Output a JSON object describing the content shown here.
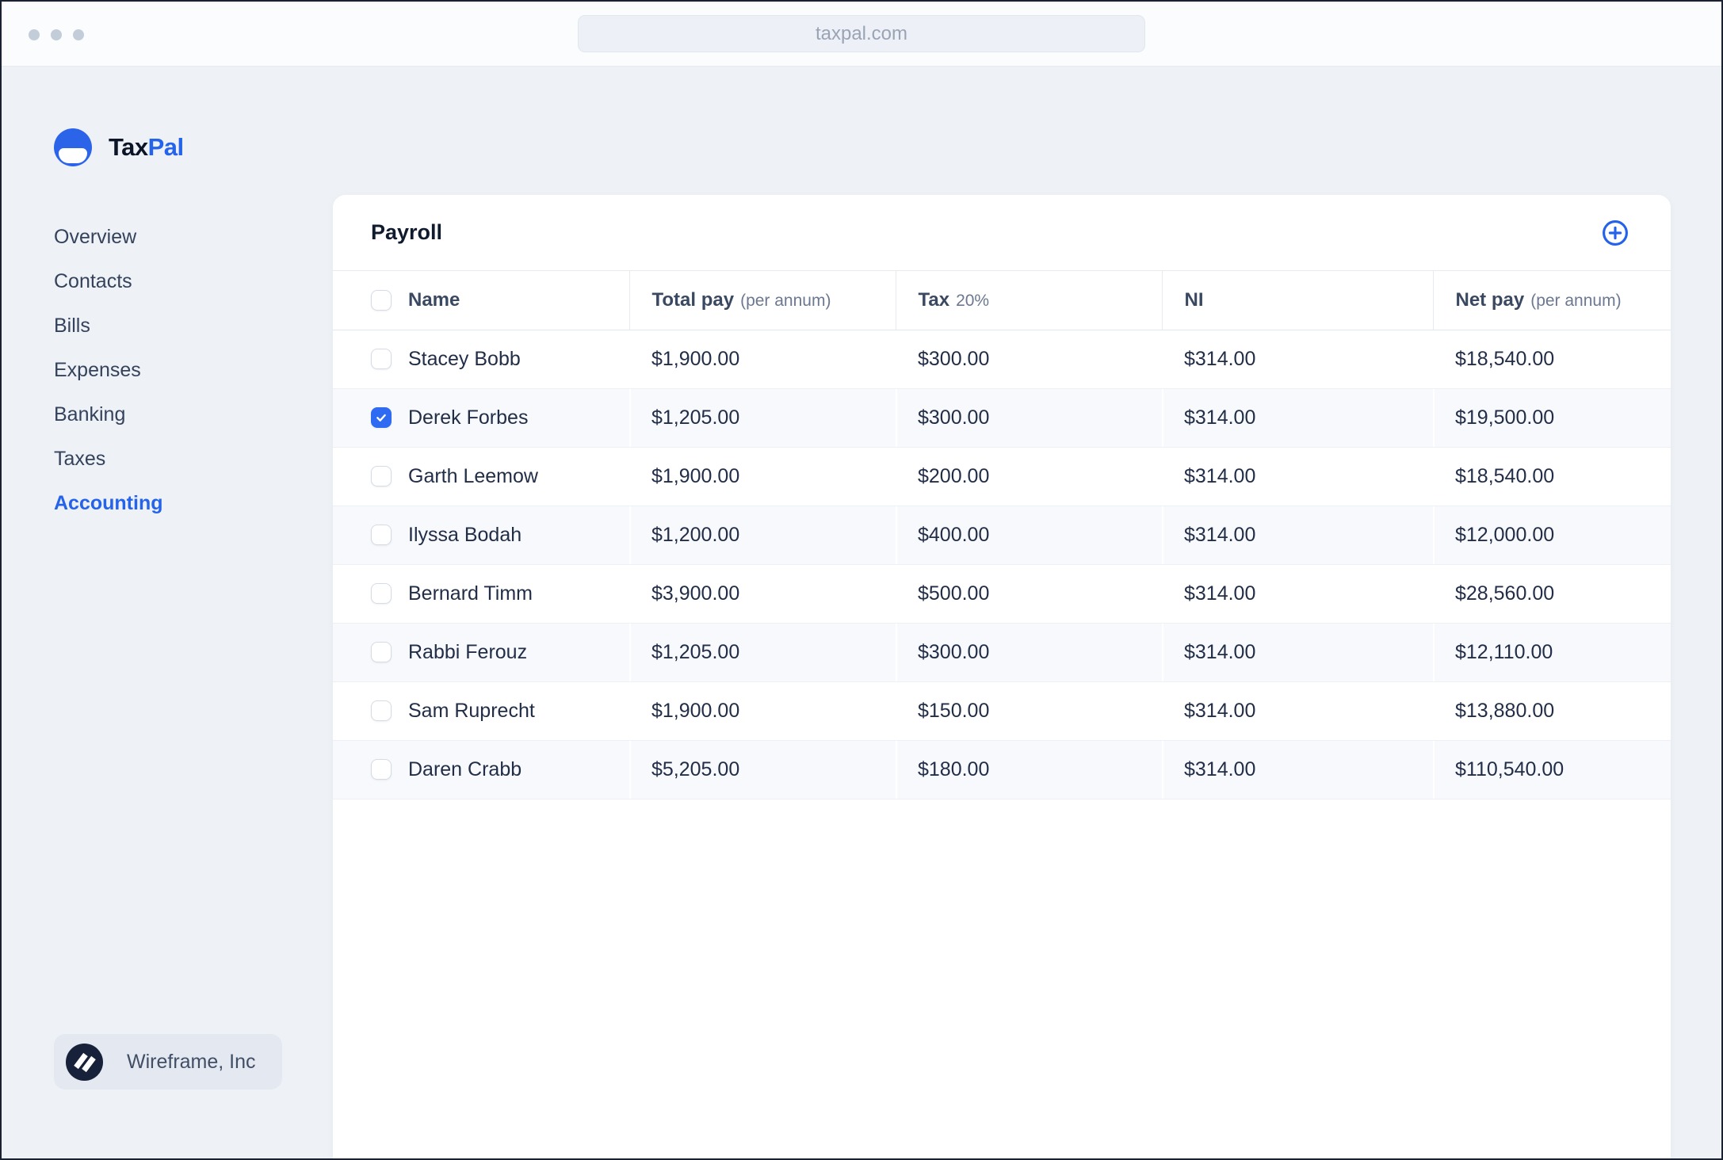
{
  "browser": {
    "url": "taxpal.com"
  },
  "sidebar": {
    "brand": {
      "primary": "Tax",
      "secondary": "Pal"
    },
    "nav": [
      {
        "label": "Overview",
        "active": false
      },
      {
        "label": "Contacts",
        "active": false
      },
      {
        "label": "Bills",
        "active": false
      },
      {
        "label": "Expenses",
        "active": false
      },
      {
        "label": "Banking",
        "active": false
      },
      {
        "label": "Taxes",
        "active": false
      },
      {
        "label": "Accounting",
        "active": true
      }
    ],
    "org": {
      "name": "Wireframe, Inc"
    }
  },
  "payroll": {
    "title": "Payroll",
    "add_button": {
      "icon": "plus-circle-icon"
    },
    "table": {
      "columns": [
        {
          "label": "Name",
          "sub": ""
        },
        {
          "label": "Total pay",
          "sub": "(per annum)"
        },
        {
          "label": "Tax",
          "sub": "20%"
        },
        {
          "label": "NI",
          "sub": ""
        },
        {
          "label": "Net pay",
          "sub": "(per annum)"
        }
      ],
      "rows": [
        {
          "name": "Stacey Bobb",
          "total_pay": "$1,900.00",
          "tax": "$300.00",
          "ni": "$314.00",
          "net_pay": "$18,540.00",
          "checked": false
        },
        {
          "name": "Derek Forbes",
          "total_pay": "$1,205.00",
          "tax": "$300.00",
          "ni": "$314.00",
          "net_pay": "$19,500.00",
          "checked": true
        },
        {
          "name": "Garth Leemow",
          "total_pay": "$1,900.00",
          "tax": "$200.00",
          "ni": "$314.00",
          "net_pay": "$18,540.00",
          "checked": false
        },
        {
          "name": "Ilyssa Bodah",
          "total_pay": "$1,200.00",
          "tax": "$400.00",
          "ni": "$314.00",
          "net_pay": "$12,000.00",
          "checked": false
        },
        {
          "name": "Bernard Timm",
          "total_pay": "$3,900.00",
          "tax": "$500.00",
          "ni": "$314.00",
          "net_pay": "$28,560.00",
          "checked": false
        },
        {
          "name": "Rabbi Ferouz",
          "total_pay": "$1,205.00",
          "tax": "$300.00",
          "ni": "$314.00",
          "net_pay": "$12,110.00",
          "checked": false
        },
        {
          "name": "Sam Ruprecht",
          "total_pay": "$1,900.00",
          "tax": "$150.00",
          "ni": "$314.00",
          "net_pay": "$13,880.00",
          "checked": false
        },
        {
          "name": "Daren Crabb",
          "total_pay": "$5,205.00",
          "tax": "$180.00",
          "ni": "$314.00",
          "net_pay": "$110,540.00",
          "checked": false
        }
      ]
    }
  },
  "colors": {
    "accent": "#2563eb",
    "checkbox": "#2e6bf2",
    "app_bg": "#eef2f6",
    "stripe": "#f7f9fc",
    "dark_text": "#111b2e"
  }
}
